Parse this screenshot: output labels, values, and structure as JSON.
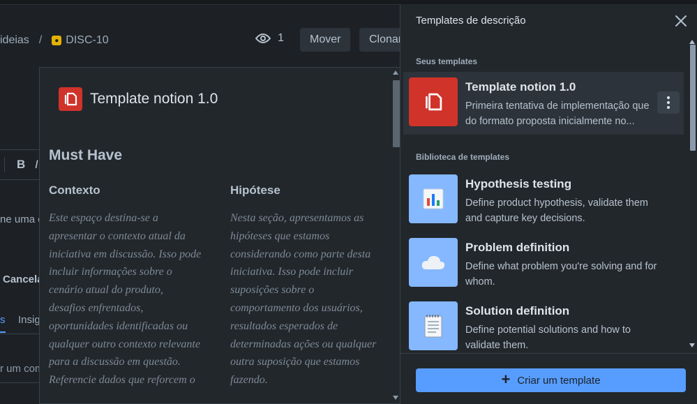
{
  "breadcrumb": {
    "parent": "ideias",
    "separator": "/",
    "issue_key": "DISC-10"
  },
  "header": {
    "watchers_count": "1",
    "move_label": "Mover",
    "clone_label": "Clonar"
  },
  "editor": {
    "bold_label": "B",
    "italic_label": "I",
    "text_fragment": "ne uma c",
    "cancel_label": "Cancela",
    "tab_active": "s",
    "tab_insights": "Insig",
    "comment_placeholder": "r um com"
  },
  "preview": {
    "title": "Template notion 1.0",
    "section_title": "Must Have",
    "col1_title": "Contexto",
    "col1_text": "Este espaço destina-se a apresentar o contexto atual da iniciativa em discussão. Isso pode incluir informações sobre o cenário atual do produto, desafios enfrentados, oportunidades identificadas ou qualquer outro contexto relevante para a discussão em questão. Referencie dados que reforcem o",
    "col2_title": "Hipótese",
    "col2_text": "Nesta seção, apresentamos as hipóteses que estamos considerando como parte desta iniciativa. Isso pode incluir suposições sobre o comportamento dos usuários, resultados esperados de determinadas ações ou qualquer outra suposição que estamos fazendo."
  },
  "panel": {
    "title": "Templates de descrição",
    "my_templates_label": "Seus templates",
    "library_label": "Biblioteca de templates",
    "my_templates": [
      {
        "title": "Template notion 1.0",
        "description": "Primeira tentativa de implementação que do formato proposta inicialmente no...",
        "icon": "copy-document-icon",
        "color": "#d0332a"
      }
    ],
    "library": [
      {
        "title": "Hypothesis testing",
        "description": "Define product hypothesis, validate them and capture key decisions.",
        "icon": "bar-chart-icon",
        "color": "#85b8ff"
      },
      {
        "title": "Problem definition",
        "description": "Define what problem you're solving and for whom.",
        "icon": "cloud-icon",
        "color": "#85b8ff"
      },
      {
        "title": "Solution definition",
        "description": "Define potential solutions and how to validate them.",
        "icon": "notepad-icon",
        "color": "#85b8ff"
      }
    ],
    "create_label": "Criar um template"
  },
  "colors": {
    "accent": "#579dff",
    "background": "#1d2125",
    "panel": "#22272b"
  }
}
